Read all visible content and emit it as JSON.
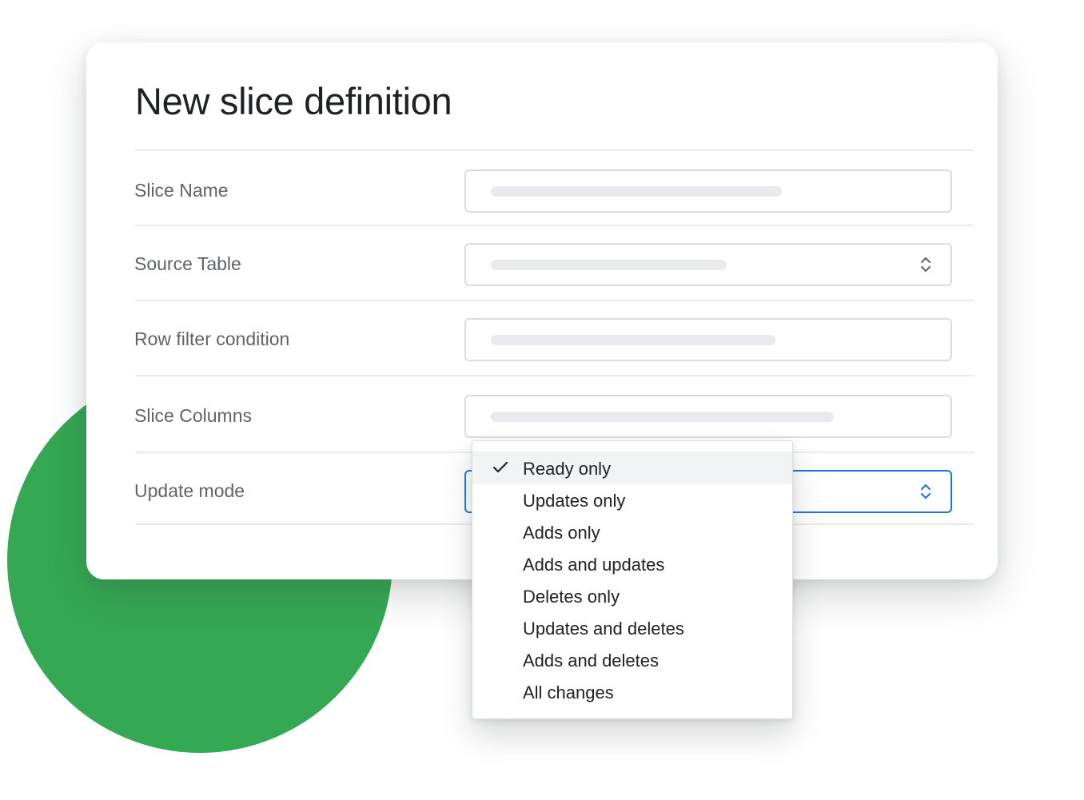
{
  "dialog": {
    "title": "New slice definition"
  },
  "fields": {
    "slice_name": {
      "label": "Slice Name"
    },
    "source_table": {
      "label": "Source Table"
    },
    "row_filter": {
      "label": "Row filter condition"
    },
    "slice_columns": {
      "label": "Slice Columns"
    },
    "update_mode": {
      "label": "Update mode"
    }
  },
  "update_mode_menu": {
    "selected": "Ready only",
    "options": [
      "Ready only",
      "Updates only",
      "Adds only",
      "Adds and updates",
      "Deletes only",
      "Updates and deletes",
      "Adds and deletes",
      "All changes"
    ]
  },
  "colors": {
    "accent": "#1a73e8",
    "decor_circle": "#34a853",
    "placeholder": "#e8eaed"
  },
  "icons": {
    "selected_option": "check-icon",
    "select_arrows": "unfold-arrows-icon"
  }
}
